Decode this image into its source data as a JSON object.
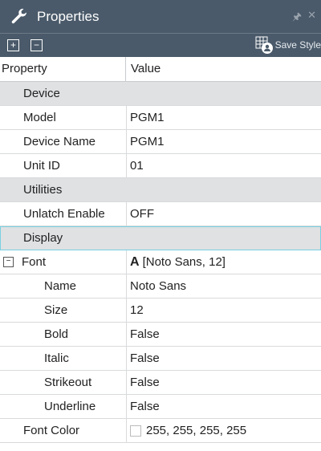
{
  "window": {
    "title": "Properties",
    "pin_icon": "pin-icon",
    "close_icon": "close-icon"
  },
  "toolbar": {
    "expand_all": "+",
    "collapse_all": "−",
    "save_style": "Save Style"
  },
  "columns": {
    "property": "Property",
    "value": "Value"
  },
  "sections": {
    "device": "Device",
    "utilities": "Utilities",
    "display": "Display"
  },
  "rows": {
    "model": {
      "label": "Model",
      "value": "PGM1"
    },
    "device_name": {
      "label": "Device Name",
      "value": "PGM1"
    },
    "unit_id": {
      "label": "Unit ID",
      "value": "01"
    },
    "unlatch": {
      "label": "Unlatch Enable",
      "value": "OFF"
    },
    "font": {
      "label": "Font",
      "value": "[Noto Sans, 12]",
      "glyph": "A",
      "expander": "⊟"
    },
    "name": {
      "label": "Name",
      "value": "Noto Sans"
    },
    "size": {
      "label": "Size",
      "value": "12"
    },
    "bold": {
      "label": "Bold",
      "value": "False"
    },
    "italic": {
      "label": "Italic",
      "value": "False"
    },
    "strikeout": {
      "label": "Strikeout",
      "value": "False"
    },
    "underline": {
      "label": "Underline",
      "value": "False"
    },
    "font_color": {
      "label": "Font Color",
      "value": "255, 255, 255, 255"
    }
  },
  "colors": {
    "titlebar": "#4a5a6a",
    "category": "#dfe1e3",
    "selection": "#7ad0e0"
  }
}
